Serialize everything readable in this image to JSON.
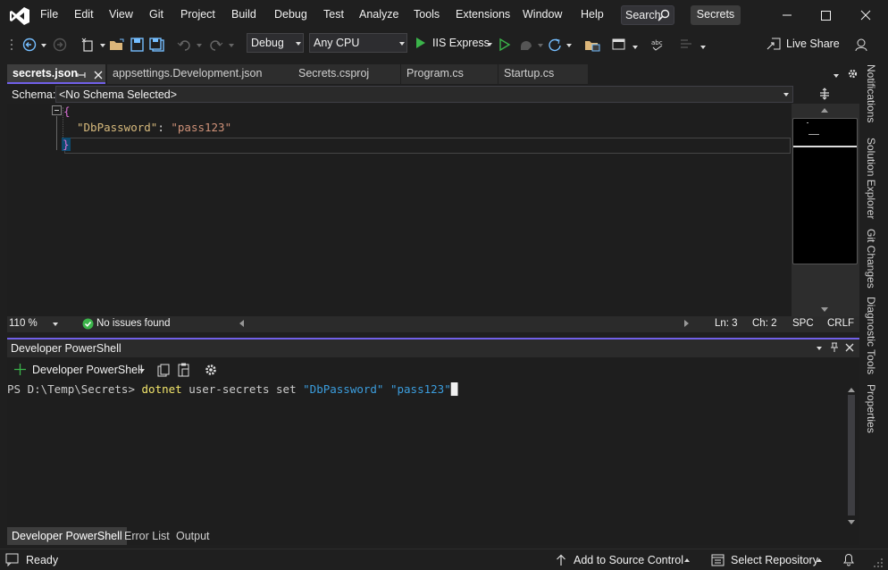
{
  "menu": {
    "items": [
      "File",
      "Edit",
      "View",
      "Git",
      "Project",
      "Build",
      "Debug",
      "Test",
      "Analyze",
      "Tools",
      "Extensions",
      "Window",
      "Help"
    ],
    "search_label": "Search",
    "solution_name": "Secrets"
  },
  "toolbar": {
    "config_value": "Debug",
    "platform_value": "Any CPU",
    "run_label": "IIS Express",
    "live_share_label": "Live Share"
  },
  "tabs": [
    {
      "label": "secrets.json",
      "active": true
    },
    {
      "label": "appsettings.Development.json",
      "active": false
    },
    {
      "label": "Secrets.csproj",
      "active": false
    },
    {
      "label": "Program.cs",
      "active": false
    },
    {
      "label": "Startup.cs",
      "active": false
    }
  ],
  "schema": {
    "label": "Schema:",
    "value": "<No Schema Selected>"
  },
  "editor": {
    "line1": "{",
    "key": "\"DbPassword\"",
    "colon": ": ",
    "value": "\"pass123\"",
    "line3": "}",
    "colors": {
      "key": "#d7ba7d",
      "string": "#ce9178",
      "brace": "#da70d6"
    }
  },
  "editor_status": {
    "zoom": "110 %",
    "issues": "No issues found",
    "line": "Ln: 3",
    "char": "Ch: 2",
    "whitespace": "SPC",
    "line_ending": "CRLF"
  },
  "terminal": {
    "title": "Developer PowerShell",
    "new_terminal_label": "Developer PowerShell",
    "prompt": "PS D:\\Temp\\Secrets> ",
    "cmd": "dotnet",
    "args": " user-secrets set ",
    "arg1": "\"DbPassword\"",
    "space": " ",
    "arg2": "\"pass123\""
  },
  "panel_tabs": [
    "Developer PowerShell",
    "Error List",
    "Output"
  ],
  "right_rail": [
    "Notifications",
    "Solution Explorer",
    "Git Changes",
    "Diagnostic Tools",
    "Properties"
  ],
  "statusbar": {
    "ready": "Ready",
    "source_control": "Add to Source Control",
    "repository": "Select Repository"
  },
  "colors": {
    "accent": "#7160e8",
    "run": "#4ec9b0",
    "ok": "#3bb44a"
  }
}
